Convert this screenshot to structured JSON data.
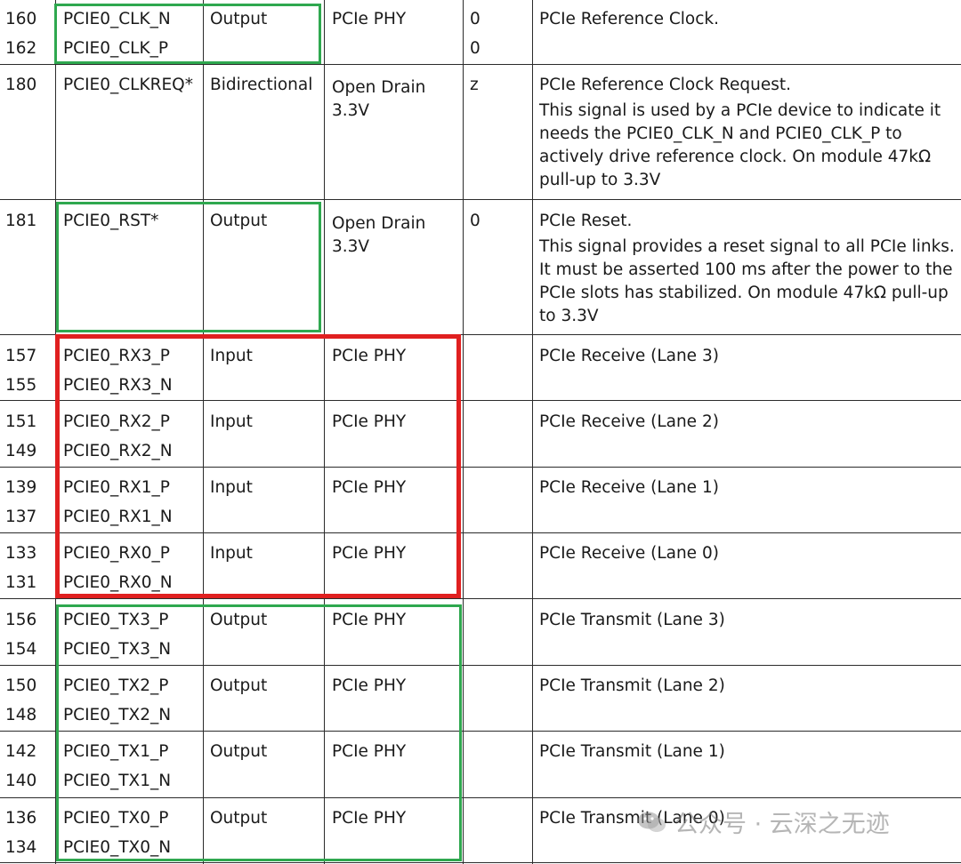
{
  "rows": [
    {
      "pins": [
        "160",
        "162"
      ],
      "signals": [
        "PCIE0_CLK_N",
        "PCIE0_CLK_P"
      ],
      "direction": "Output",
      "type": "PCIe PHY",
      "pu": [
        "0",
        "0"
      ],
      "desc": [
        "PCIe Reference Clock."
      ]
    },
    {
      "pins": [
        "180"
      ],
      "signals": [
        "PCIE0_CLKREQ*"
      ],
      "direction": "Bidirectional",
      "type": "Open Drain 3.3V",
      "pu": [
        "z"
      ],
      "desc": [
        "PCIe Reference Clock Request.",
        "This signal is used by a PCIe device to indicate it needs the PCIE0_CLK_N and PCIE0_CLK_P to actively drive reference clock. On module 47kΩ pull-up to 3.3V"
      ]
    },
    {
      "pins": [
        "181"
      ],
      "signals": [
        "PCIE0_RST*"
      ],
      "direction": "Output",
      "type": "Open Drain 3.3V",
      "pu": [
        "0"
      ],
      "desc": [
        "PCIe Reset.",
        "This signal provides a reset signal to all PCIe links. It must be asserted 100 ms after the power to the PCIe slots has stabilized. On module 47kΩ pull-up to 3.3V"
      ]
    },
    {
      "pins": [
        "157",
        "155"
      ],
      "signals": [
        "PCIE0_RX3_P",
        "PCIE0_RX3_N"
      ],
      "direction": "Input",
      "type": "PCIe PHY",
      "pu": [],
      "desc": [
        "PCIe Receive (Lane 3)"
      ]
    },
    {
      "pins": [
        "151",
        "149"
      ],
      "signals": [
        "PCIE0_RX2_P",
        "PCIE0_RX2_N"
      ],
      "direction": "Input",
      "type": "PCIe PHY",
      "pu": [],
      "desc": [
        "PCIe Receive (Lane 2)"
      ]
    },
    {
      "pins": [
        "139",
        "137"
      ],
      "signals": [
        "PCIE0_RX1_P",
        "PCIE0_RX1_N"
      ],
      "direction": "Input",
      "type": "PCIe PHY",
      "pu": [],
      "desc": [
        "PCIe Receive (Lane 1)"
      ]
    },
    {
      "pins": [
        "133",
        "131"
      ],
      "signals": [
        "PCIE0_RX0_P",
        "PCIE0_RX0_N"
      ],
      "direction": "Input",
      "type": "PCIe PHY",
      "pu": [],
      "desc": [
        "PCIe Receive (Lane 0)"
      ]
    },
    {
      "pins": [
        "156",
        "154"
      ],
      "signals": [
        "PCIE0_TX3_P",
        "PCIE0_TX3_N"
      ],
      "direction": "Output",
      "type": "PCIe PHY",
      "pu": [],
      "desc": [
        "PCIe Transmit (Lane 3)"
      ]
    },
    {
      "pins": [
        "150",
        "148"
      ],
      "signals": [
        "PCIE0_TX2_P",
        "PCIE0_TX2_N"
      ],
      "direction": "Output",
      "type": "PCIe PHY",
      "pu": [],
      "desc": [
        "PCIe Transmit (Lane 2)"
      ]
    },
    {
      "pins": [
        "142",
        "140"
      ],
      "signals": [
        "PCIE0_TX1_P",
        "PCIE0_TX1_N"
      ],
      "direction": "Output",
      "type": "PCIe PHY",
      "pu": [],
      "desc": [
        "PCIe Transmit (Lane 1)"
      ]
    },
    {
      "pins": [
        "136",
        "134"
      ],
      "signals": [
        "PCIE0_TX0_P",
        "PCIE0_TX0_N"
      ],
      "direction": "Output",
      "type": "PCIe PHY",
      "pu": [],
      "desc": [
        "PCIe Transmit (Lane 0)"
      ]
    }
  ],
  "watermark": {
    "text": "公众号 · 云深之无迹",
    "icon": "wechat-icon"
  },
  "colors": {
    "green_highlight": "#2fa84f",
    "red_highlight": "#e02020",
    "grid": "#2b2b2b"
  }
}
